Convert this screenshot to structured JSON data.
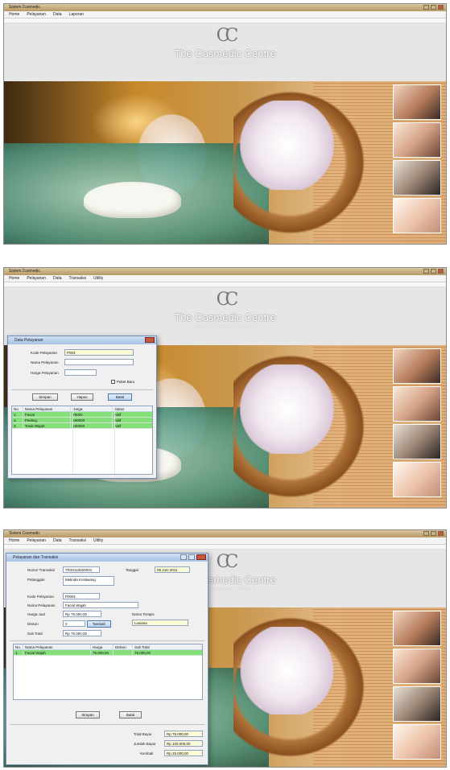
{
  "screens": [
    {
      "window_title": "Sistem Cosmedic",
      "menu": [
        "Home",
        "Pelayanan",
        "Data",
        "Laporan"
      ]
    },
    {
      "window_title": "Sistem Cosmedic",
      "menu": [
        "Home",
        "Pelayanan",
        "Data",
        "Transaksi",
        "Utility"
      ]
    },
    {
      "window_title": "Sistem Cosmedic",
      "menu": [
        "Home",
        "Pelayanan",
        "Data",
        "Transaksi",
        "Utility"
      ]
    }
  ],
  "brand": {
    "monogram": "CC",
    "name": "The Cosmedic Centre",
    "tagline": "Aesthetic | Beauty | Anti-Aging"
  },
  "dialog_pelayanan": {
    "title": "Data Pelayanan",
    "fields": {
      "kode_label": "Kode Pelayanan",
      "kode_value": "P003",
      "nama_label": "Nama Pelayanan",
      "nama_value": "",
      "harga_label": "Harga Pelayanan",
      "harga_value": ""
    },
    "checkbox_label": "Paket Baru",
    "buttons": {
      "simpan": "Simpan",
      "hapus": "Hapus",
      "batal": "Batal"
    },
    "columns": [
      "No.",
      "Nama Pelayanan",
      "Harga",
      "Status"
    ],
    "rows": [
      {
        "no": "1.",
        "nama": "Facial",
        "harga": "75000",
        "status": "Aktif"
      },
      {
        "no": "2.",
        "nama": "Peeling",
        "harga": "150000",
        "status": "Aktif"
      },
      {
        "no": "3.",
        "nama": "Totok Wajah",
        "harga": "100000",
        "status": "Aktif"
      }
    ]
  },
  "dialog_transaksi": {
    "title": "Pelayanan dan Transaksi",
    "fields": {
      "no_transaksi_label": "Nomor Transaksi",
      "no_transaksi_value": "TR20110020001",
      "tanggal_label": "Tanggal",
      "tanggal_value": "08 Juni 2011",
      "pelanggan_label": "Pelanggan",
      "pelanggan_value": "Melinda Kristiwang",
      "kode_label": "Kode Pelayanan",
      "kode_value": "P0001",
      "nama_label": "Nama Pelayanan",
      "nama_value": "Facial Wajah",
      "harga_label": "Harga Jual",
      "harga_value": "Rp 75.000,00",
      "diskon_label": "Diskon",
      "diskon_value": "0",
      "terapis_label": "Nama Terapis",
      "terapis_value": "Lusiana",
      "subtotal_label": "Sub Total",
      "subtotal_value": "Rp 75.000,00"
    },
    "tambah_button": "Tambah",
    "columns": [
      "No.",
      "Nama Pelayanan",
      "Harga",
      "Diskon",
      "Sub Total"
    ],
    "rows": [
      {
        "no": "1.",
        "nama": "Facial Wajah",
        "harga": "75.000,00",
        "diskon": "",
        "subtotal": "75.000,00"
      }
    ],
    "buttons": {
      "simpan": "Simpan",
      "batal": "Batal"
    },
    "totals": {
      "total_label": "Total Bayar",
      "total_value": "Rp 75.000,00",
      "bayar_label": "Jumlah Bayar",
      "bayar_value": "Rp 100.000,00",
      "kembali_label": "Kembali",
      "kembali_value": "Rp 25.000,00"
    }
  },
  "colors": {
    "selected_row": "#86e07a",
    "titlebar": "#b89a64",
    "dialog_title": "#a7c1e3"
  }
}
